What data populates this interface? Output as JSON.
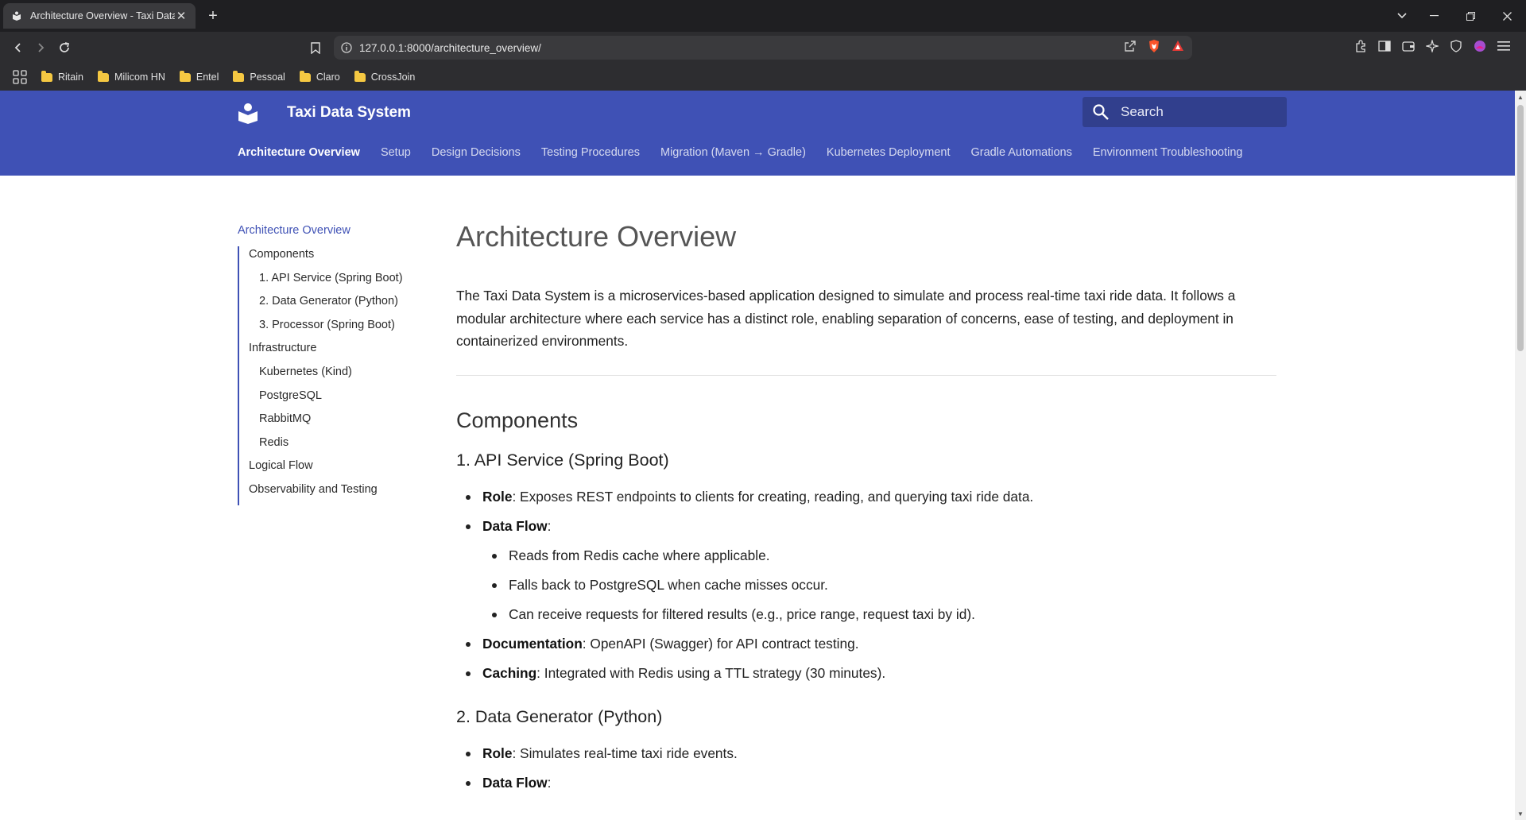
{
  "browser": {
    "tab_title": "Architecture Overview - Taxi Data",
    "url": "127.0.0.1:8000/architecture_overview/",
    "bookmarks": [
      "Ritain",
      "Milicom HN",
      "Entel",
      "Pessoal",
      "Claro",
      "CrossJoin"
    ]
  },
  "site": {
    "title": "Taxi Data System",
    "search_placeholder": "Search",
    "tabs": [
      "Architecture Overview",
      "Setup",
      "Design Decisions",
      "Testing Procedures",
      "Migration (Maven → Gradle)",
      "Kubernetes Deployment",
      "Gradle Automations",
      "Environment Troubleshooting"
    ],
    "accent_color": "#3f51b5"
  },
  "toc": {
    "root": "Architecture Overview",
    "items": [
      {
        "label": "Components",
        "level": 1
      },
      {
        "label": "1. API Service (Spring Boot)",
        "level": 2
      },
      {
        "label": "2. Data Generator (Python)",
        "level": 2
      },
      {
        "label": "3. Processor (Spring Boot)",
        "level": 2
      },
      {
        "label": "Infrastructure",
        "level": 1
      },
      {
        "label": "Kubernetes (Kind)",
        "level": 2
      },
      {
        "label": "PostgreSQL",
        "level": 2
      },
      {
        "label": "RabbitMQ",
        "level": 2
      },
      {
        "label": "Redis",
        "level": 2
      },
      {
        "label": "Logical Flow",
        "level": 1
      },
      {
        "label": "Observability and Testing",
        "level": 1
      }
    ]
  },
  "article": {
    "title": "Architecture Overview",
    "intro": "The Taxi Data System is a microservices-based application designed to simulate and process real-time taxi ride data. It follows a modular architecture where each service has a distinct role, enabling separation of concerns, ease of testing, and deployment in containerized environments.",
    "components_heading": "Components",
    "api": {
      "heading": "1. API Service (Spring Boot)",
      "role_label": "Role",
      "role_text": ": Exposes REST endpoints to clients for creating, reading, and querying taxi ride data.",
      "flow_label": "Data Flow",
      "flow_colon": ":",
      "flow_items": [
        "Reads from Redis cache where applicable.",
        "Falls back to PostgreSQL when cache misses occur.",
        "Can receive requests for filtered results (e.g., price range, request taxi by id)."
      ],
      "doc_label": "Documentation",
      "doc_text": ": OpenAPI (Swagger) for API contract testing.",
      "cache_label": "Caching",
      "cache_text": ": Integrated with Redis using a TTL strategy (30 minutes)."
    },
    "generator": {
      "heading": "2. Data Generator (Python)",
      "role_label": "Role",
      "role_text": ": Simulates real-time taxi ride events.",
      "flow_label": "Data Flow",
      "flow_colon": ":"
    }
  }
}
